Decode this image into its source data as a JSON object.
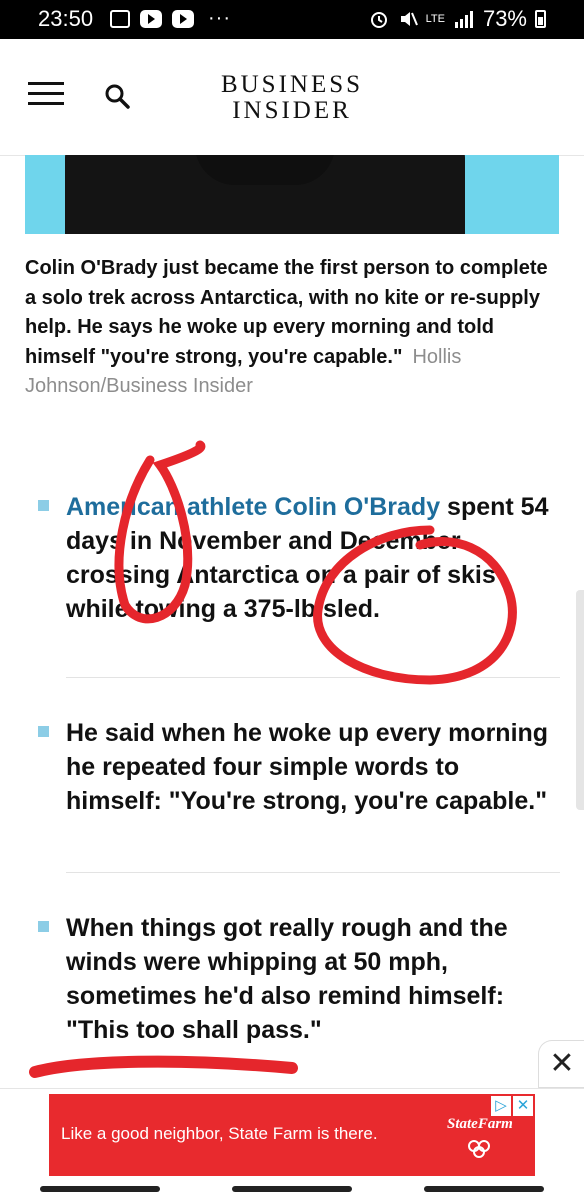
{
  "status_bar": {
    "time": "23:50",
    "dots": "···",
    "network": "LTE",
    "battery": "73%"
  },
  "header": {
    "logo_line1": "BUSINESS",
    "logo_line2": "INSIDER"
  },
  "article": {
    "caption": "Colin O'Brady just became the first person to complete a solo trek across Antarctica, with no kite or re-supply help. He says he woke up every morning and told himself \"you're strong, you're capable.\"",
    "credit": "Hollis Johnson/Business Insider",
    "bullets": [
      {
        "link_text": "American athlete Colin O'Brady",
        "text": " spent 54 days in November and December crossing Antarctica on a pair of skis while towing a 375-lb sled."
      },
      {
        "text": "He said when he woke up every morning he repeated four simple words to himself: \"You're strong, you're capable.\""
      },
      {
        "text": "When things got really rough and the winds were whipping at 50 mph, sometimes he'd also remind himself: \"This too shall pass.\""
      }
    ]
  },
  "ad": {
    "text": "Like a good neighbor, State Farm is there.",
    "brand": "StateFarm",
    "close_symbol": "✕",
    "choice_play": "▷",
    "choice_close": "✕"
  },
  "colors": {
    "link": "#1e6d9c",
    "bullet_square": "#8ccde6",
    "ad_red": "#e82a2e",
    "annotation_red": "#e5262c"
  }
}
